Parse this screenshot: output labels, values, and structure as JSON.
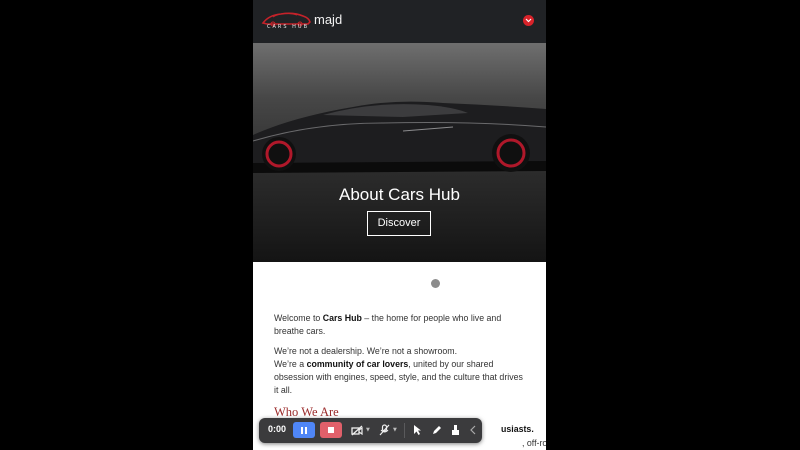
{
  "header": {
    "logo_text": "CARS HUB",
    "username": "majd"
  },
  "hero": {
    "title": "About Cars Hub",
    "button_label": "Discover"
  },
  "content": {
    "p1_prefix": "Welcome to ",
    "p1_bold": "Cars Hub",
    "p1_suffix": " – the home for people who live and breathe cars.",
    "p2_line1": "We’re not a dealership. We’re not a showroom.",
    "p2_prefix": "We’re a ",
    "p2_bold": "community of car lovers",
    "p2_suffix": ", united by our shared obsession with engines, speed, style, and the culture that drives it all.",
    "section_title": "Who We Are",
    "below_bold": "usiasts.",
    "below_text": ", off-road"
  },
  "recorder": {
    "time": "0:00"
  },
  "colors": {
    "header_bg": "#202225",
    "accent_red": "#d8232a",
    "section_title": "#9b2a2a",
    "pause_blue": "#4f86f7",
    "stop_red": "#e0606a",
    "toolbar_bg": "#3b3b3d"
  }
}
